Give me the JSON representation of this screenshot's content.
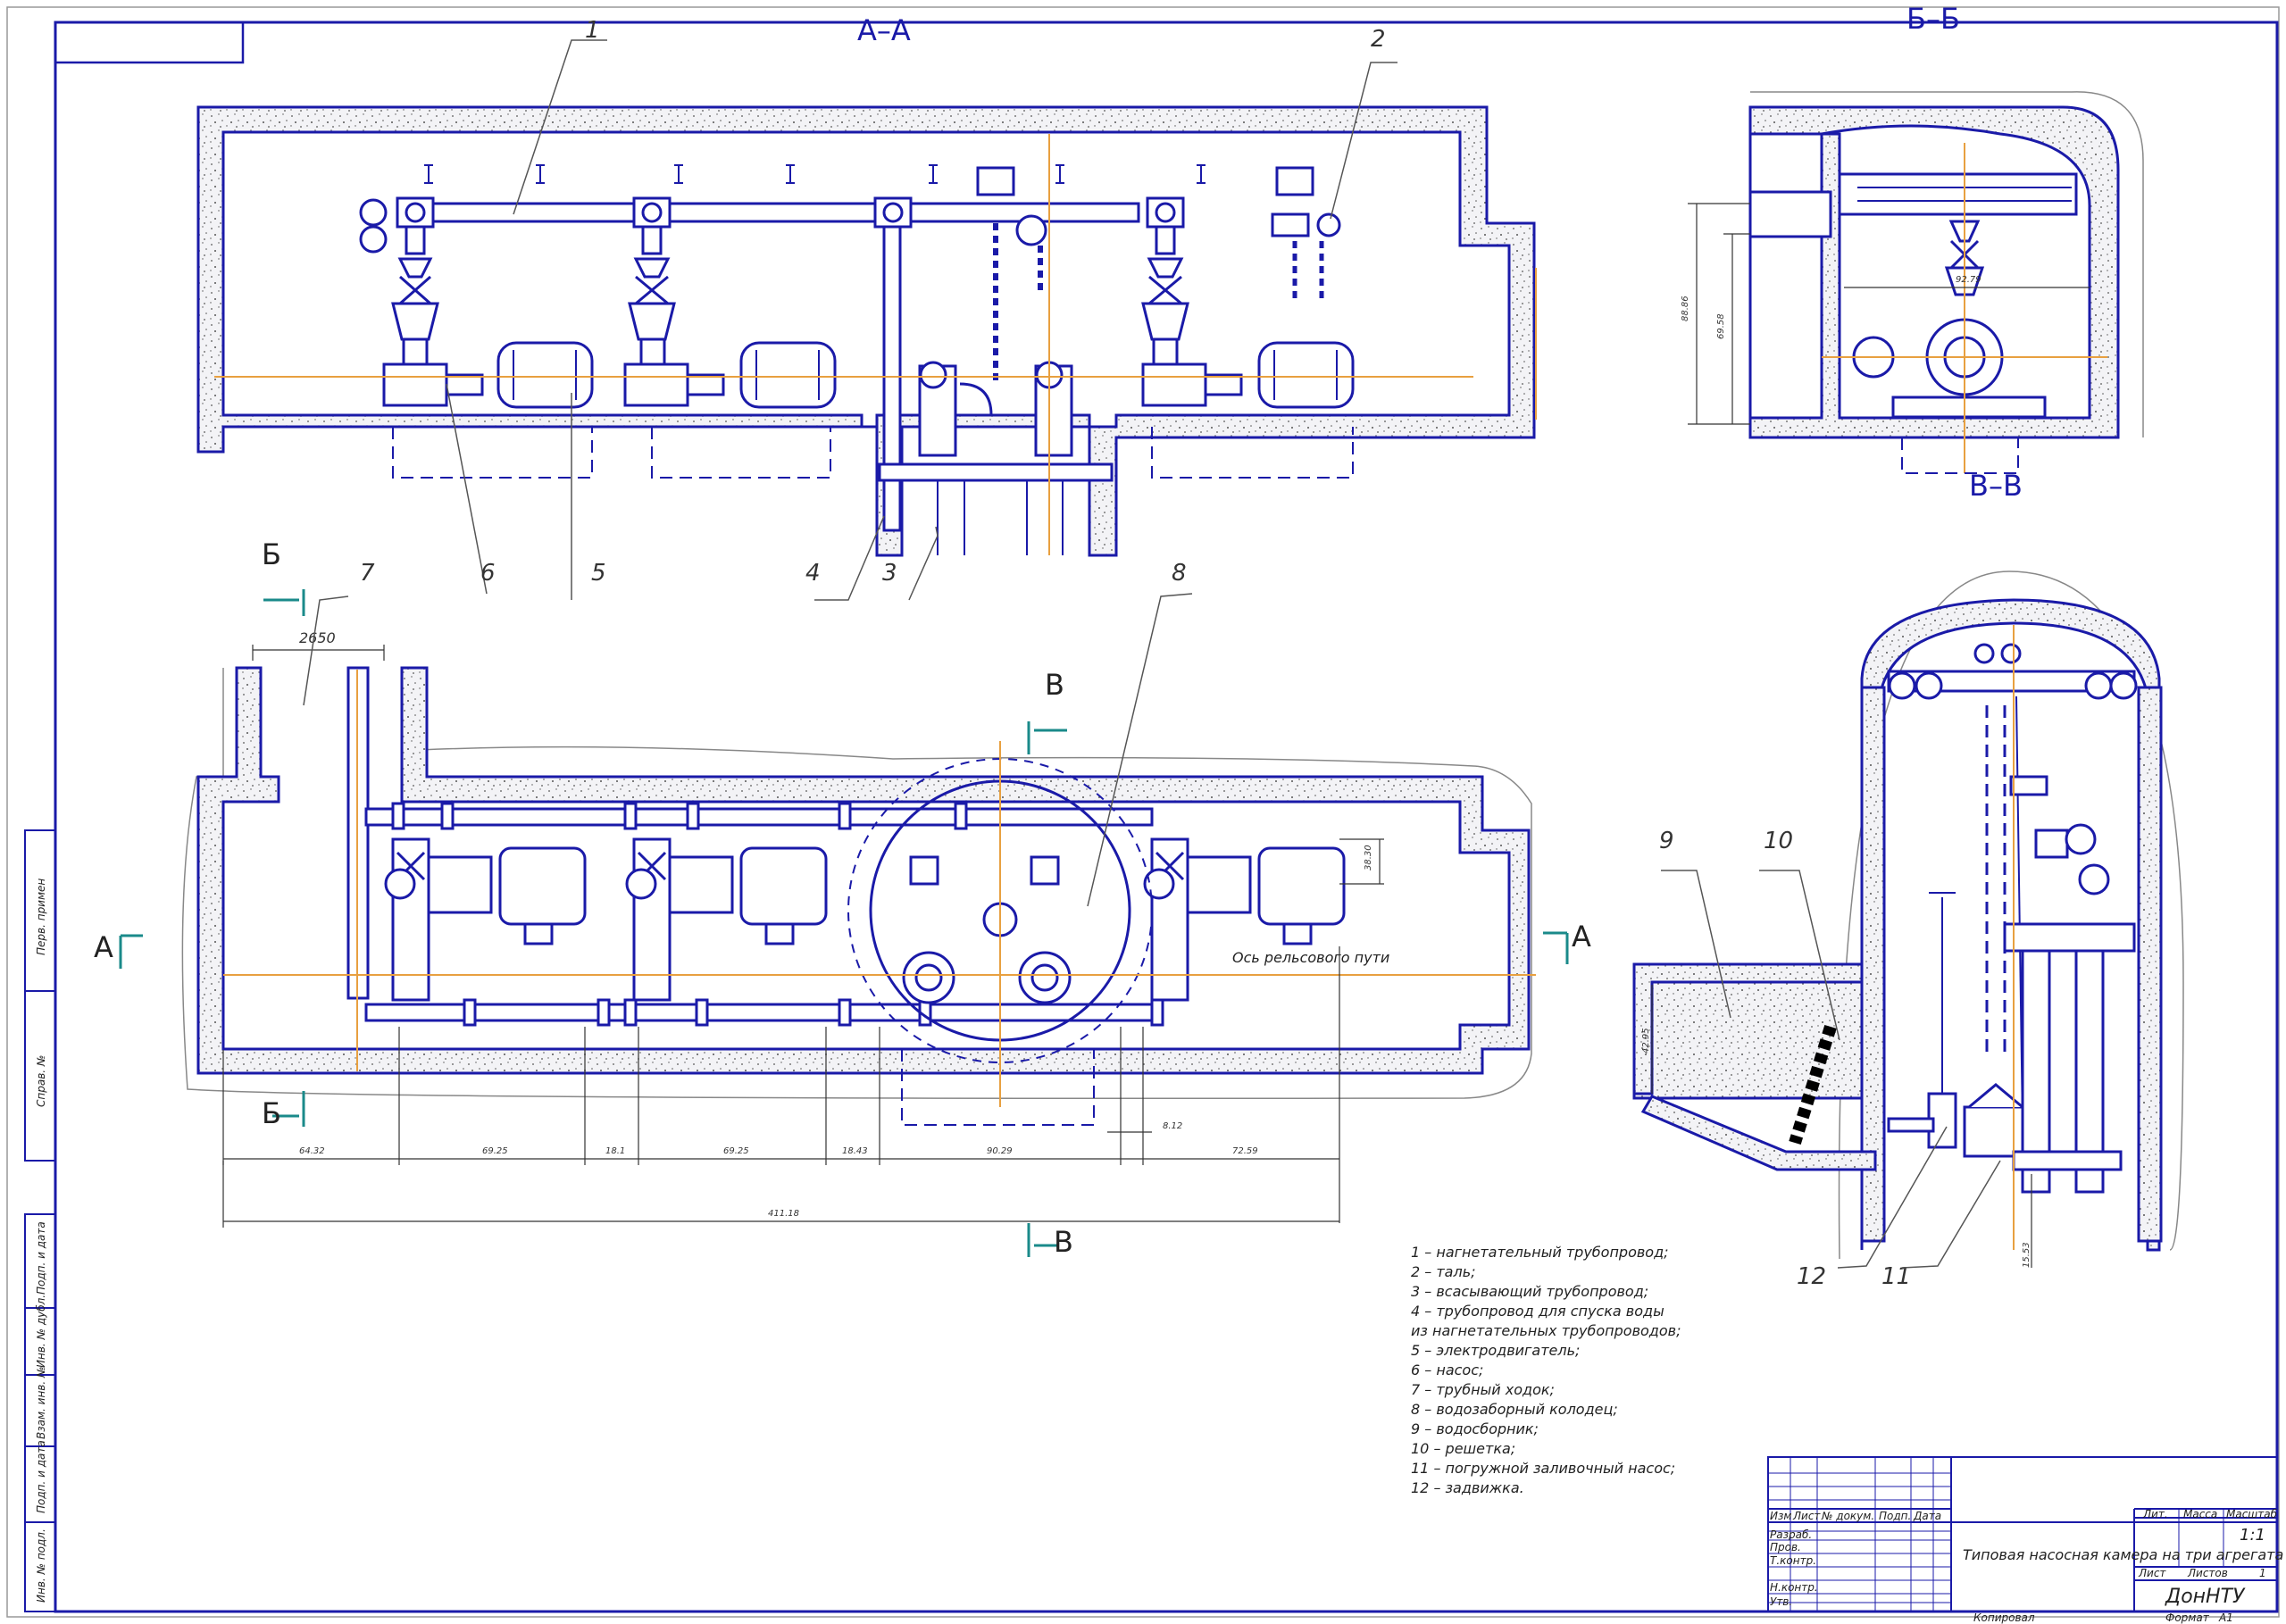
{
  "sections": {
    "aa": "А–А",
    "bb": "Б–Б",
    "vv": "В–В"
  },
  "cut_marks": {
    "b_top": "Б",
    "b_bottom": "Б",
    "v_top": "В",
    "v_bottom": "В",
    "a_left": "А",
    "a_right": "А"
  },
  "callouts": [
    "1",
    "2",
    "3",
    "4",
    "5",
    "6",
    "7",
    "8",
    "9",
    "10",
    "11",
    "12"
  ],
  "dimensions": {
    "d2650": "2650",
    "d6432": "64.32",
    "d6925a": "69.25",
    "d181": "18.1",
    "d6925b": "69.25",
    "d1843": "18.43",
    "d9029": "90.29",
    "d7259": "72.59",
    "d4118": "411.18",
    "d812": "8.12",
    "d3830": "38.30",
    "d8886": "88.86",
    "d6958": "69.58",
    "d9279": "92.79",
    "d4295": "42.95",
    "d1553": "15.53"
  },
  "rail_axis": "Ось рельсового пути",
  "legend": [
    "1 – нагнетательный трубопровод;",
    "2 – таль;",
    "3 – всасывающий трубопровод;",
    "4 – трубопровод для спуска воды",
    "из нагнетательных трубопроводов;",
    "5 – электродвигатель;",
    "6 – насос;",
    "7 – трубный ходок;",
    "8 – водозаборный колодец;",
    "9 – водосборник;",
    "10 – решетка;",
    "11 – погружной заливочный насос;",
    "12 – задвижка."
  ],
  "side_stamp": {
    "perv_primen": "Перв. примен",
    "sprav": "Справ. №",
    "podp_data1": "Подп. и дата",
    "inv_dubl": "Инв. № дубл.",
    "vzam_inv": "Взам. инв. №",
    "podp_data2": "Подп. и дата",
    "inv_podl": "Инв. № подл."
  },
  "title_block": {
    "izm": "Изм",
    "list": "Лист",
    "ndokum": "№ докум.",
    "podp": "Подп.",
    "data": "Дата",
    "razrab": "Разраб.",
    "prov": "Пров.",
    "tkontr": "Т.контр.",
    "nkontr": "Н.контр.",
    "utv": "Утв.",
    "title": "Типовая насосная камера на три агрегата",
    "lit": "Лит.",
    "massa": "Масса",
    "masshtab": "Масштаб",
    "scale_value": "1:1",
    "list_label": "Лист",
    "listov_label": "Листов",
    "listov_value": "1",
    "org": "ДонНТУ",
    "kopiroval": "Копировал",
    "format": "Формат",
    "format_value": "А1"
  }
}
